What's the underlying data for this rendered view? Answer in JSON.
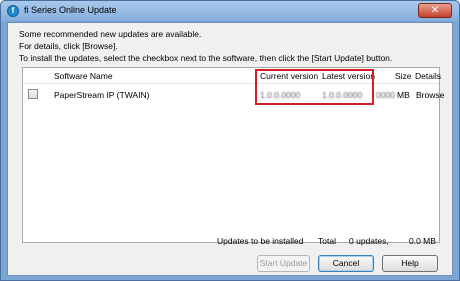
{
  "window": {
    "title": "fi Series Online Update",
    "app_icon": "fi-app-icon",
    "close_label": "✕"
  },
  "intro": {
    "line1": "Some recommended new updates are available.",
    "line2": "For details, click [Browse].",
    "line3": "To install the updates, select the checkbox next to the software, then click the [Start Update] button."
  },
  "table": {
    "headers": {
      "software_name": "Software Name",
      "current_version": "Current version",
      "latest_version": "Latest version",
      "size": "Size",
      "details": "Details"
    },
    "rows": [
      {
        "checked": false,
        "software_name": "PaperStream IP (TWAIN)",
        "current_version": "1.0.0.0000",
        "latest_version": "1.0.0.0000",
        "size": "0000",
        "size_unit": "MB",
        "details": "Browse"
      }
    ]
  },
  "status": {
    "label": "Updates to be installed",
    "total_label": "Total",
    "updates_count": "0 updates,",
    "total_size": "0.0 MB"
  },
  "buttons": {
    "start_update": "Start Update",
    "cancel": "Cancel",
    "help": "Help"
  },
  "colors": {
    "highlight_border": "#d21f2a",
    "title_bar": "#a9c8ec"
  }
}
